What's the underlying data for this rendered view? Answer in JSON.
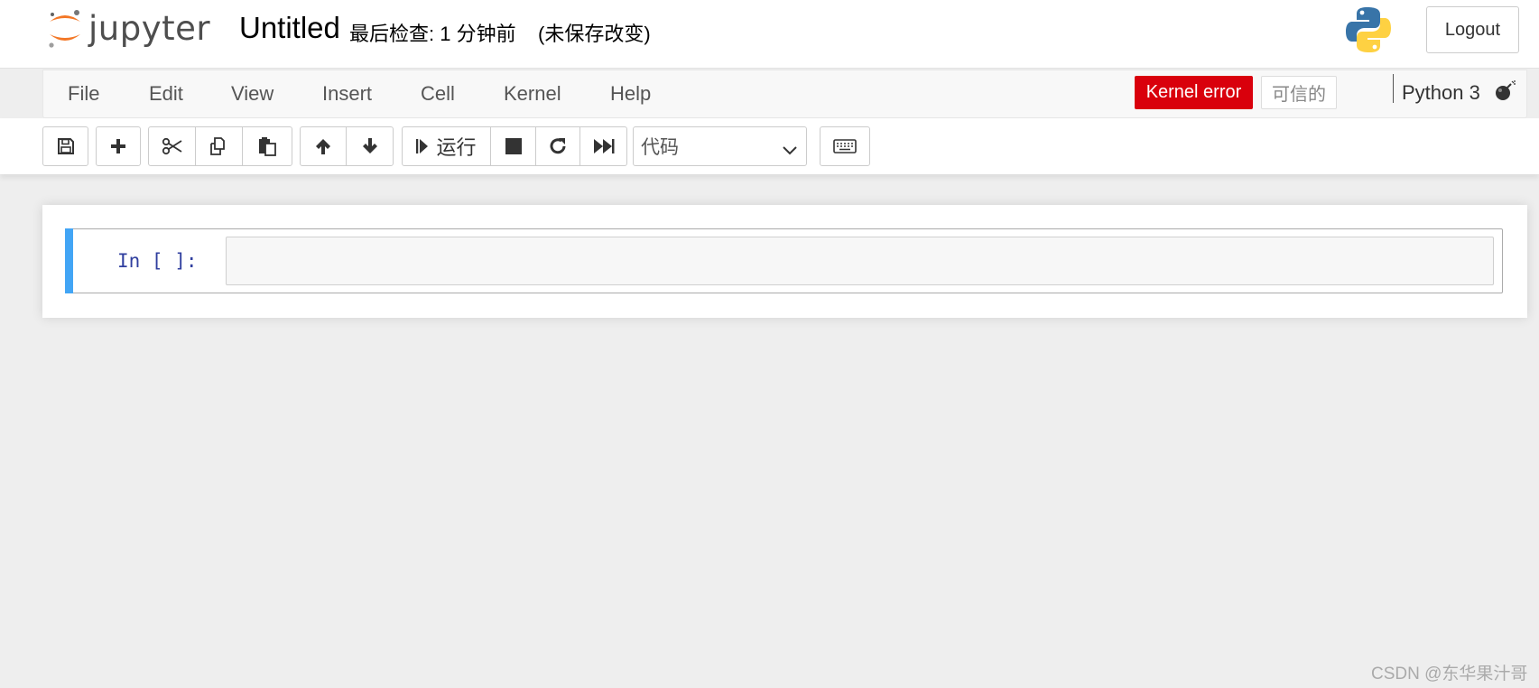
{
  "header": {
    "logo_text": "jupyter",
    "notebook_title": "Untitled",
    "checkpoint": "最后检查: 1 分钟前",
    "autosave_status": "(未保存改变)",
    "logout_label": "Logout",
    "python_logo_icon": "python-logo-icon",
    "jupyter_logo_icon": "jupyter-logo-icon"
  },
  "menubar": {
    "items": [
      "File",
      "Edit",
      "View",
      "Insert",
      "Cell",
      "Kernel",
      "Help"
    ],
    "kernel_error_label": "Kernel error",
    "trusted_label": "可信的",
    "kernel_name": "Python 3",
    "kernel_indicator_icon": "bomb-icon"
  },
  "toolbar": {
    "run_label": "运行",
    "cell_type_value": "代码",
    "icons": [
      "save-icon",
      "plus-icon",
      "scissors-icon",
      "copy-icon",
      "paste-icon",
      "arrow-up-icon",
      "arrow-down-icon",
      "step-forward-icon",
      "stop-icon",
      "restart-icon",
      "fast-forward-icon",
      "keyboard-icon"
    ]
  },
  "cell": {
    "prompt": "In [ ]:",
    "input_text": ""
  },
  "watermark": "CSDN @东华果汁哥",
  "colors": {
    "kernel_error_bg": "#d9000c",
    "cell_selected_bar": "#42a5f5",
    "prompt_color": "#303f9f",
    "jupyter_orange": "#f37726"
  }
}
